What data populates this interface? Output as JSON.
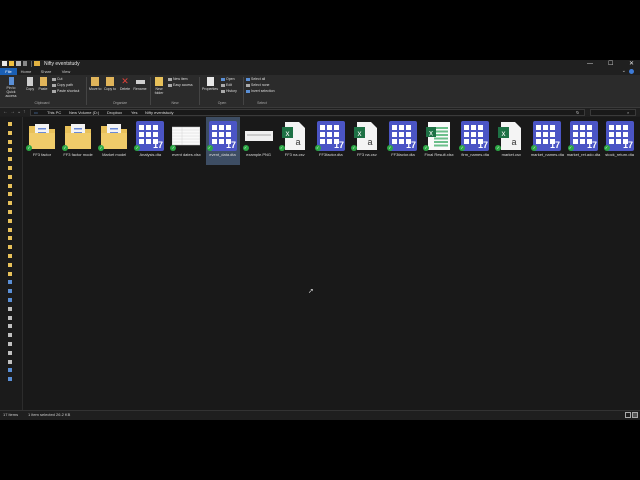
{
  "window": {
    "title": "Nifty eventstudy",
    "controls": {
      "minimize": "—",
      "maximize": "☐",
      "close": "✕"
    }
  },
  "ribbon_tabs": [
    "File",
    "Home",
    "Share",
    "View"
  ],
  "ribbon": {
    "clipboard": {
      "pin": "Pin to Quick access",
      "copy": "Copy",
      "paste": "Paste",
      "cut": "Cut",
      "copy_path": "Copy path",
      "paste_shortcut": "Paste shortcut",
      "group": "Clipboard"
    },
    "organize": {
      "move_to": "Move to",
      "copy_to": "Copy to",
      "delete": "Delete",
      "rename": "Rename",
      "group": "Organize"
    },
    "new": {
      "new_folder": "New folder",
      "new_item": "New item",
      "easy_access": "Easy access",
      "group": "New"
    },
    "open": {
      "properties": "Properties",
      "open": "Open",
      "edit": "Edit",
      "history": "History",
      "group": "Open"
    },
    "select": {
      "select_all": "Select all",
      "select_none": "Select none",
      "invert": "Invert selection",
      "group": "Select"
    }
  },
  "address": {
    "back": "←",
    "forward": "→",
    "recent": "⌄",
    "up": "↑",
    "breadcrumbs": [
      "This PC",
      "New Volume (D:)",
      "Dropbox",
      "Yes",
      "Nifty eventstudy"
    ],
    "refresh": "↻"
  },
  "files": [
    {
      "name": "FF3 factor",
      "type": "folder"
    },
    {
      "name": "FF3 factor mode",
      "type": "folder"
    },
    {
      "name": "Market model",
      "type": "folder"
    },
    {
      "name": "Analysis.dta",
      "type": "stata"
    },
    {
      "name": "event dates.xlsx",
      "type": "sheet"
    },
    {
      "name": "event_data.dta",
      "type": "stata",
      "selected": true
    },
    {
      "name": "example.PNG",
      "type": "png"
    },
    {
      "name": "FF3 na.csv",
      "type": "csv"
    },
    {
      "name": "FF3factor.dta",
      "type": "stata"
    },
    {
      "name": "FF3 na.csv",
      "type": "csv"
    },
    {
      "name": "FF3factor.dta",
      "type": "stata"
    },
    {
      "name": "Final Result.xlsx",
      "type": "xlsx"
    },
    {
      "name": "firm_names.dta",
      "type": "stata"
    },
    {
      "name": "market.csv",
      "type": "csv"
    },
    {
      "name": "market_names.dta",
      "type": "stata"
    },
    {
      "name": "market_ret.ado.dta",
      "type": "stata"
    },
    {
      "name": "stock_return.dta",
      "type": "stata"
    }
  ],
  "badge": "17",
  "status": {
    "items": "17 items",
    "selected": "1 item selected  26.2 KB"
  }
}
